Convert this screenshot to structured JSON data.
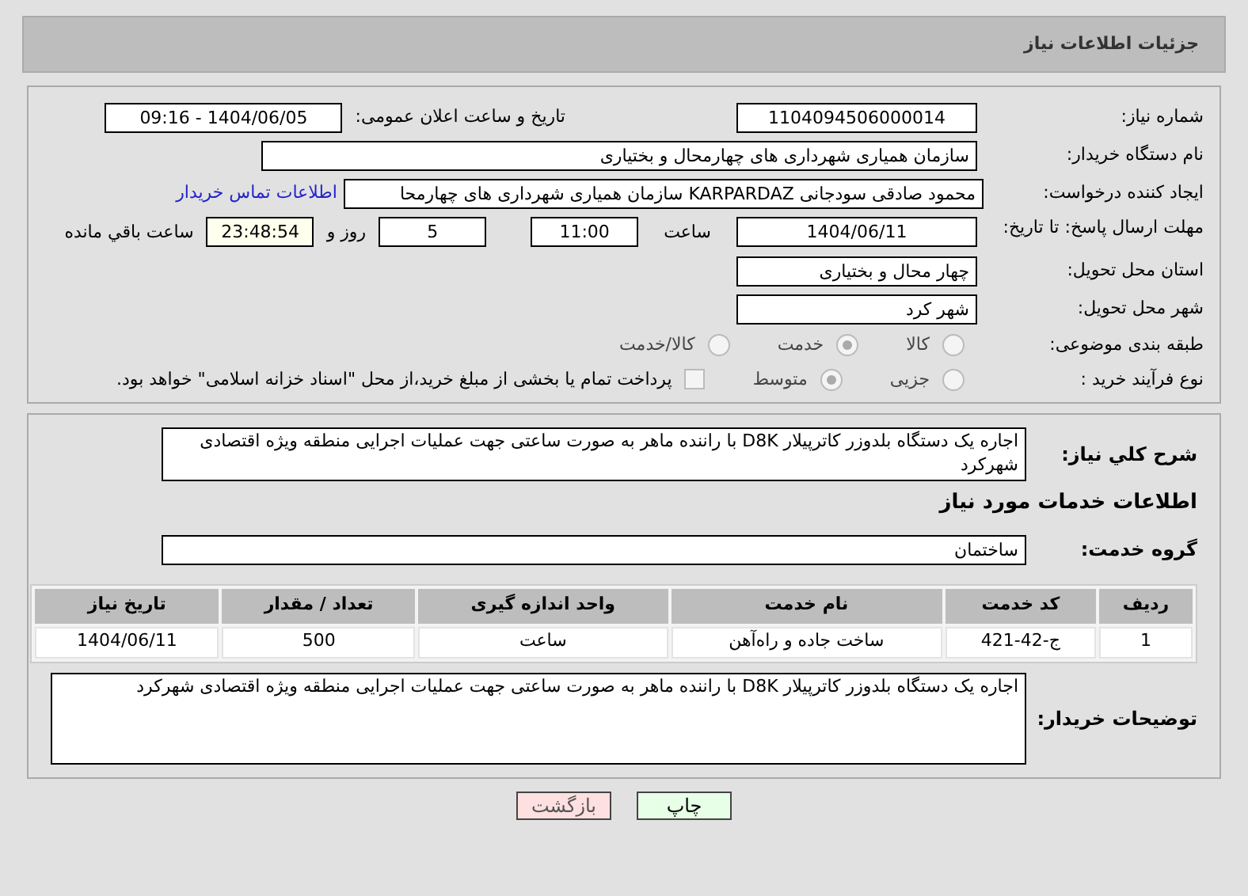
{
  "header": {
    "title": "جزئیات اطلاعات نیاز"
  },
  "details": {
    "need_number": {
      "label": "شماره نیاز:",
      "value": "1104094506000014"
    },
    "announce": {
      "label": "تاریخ و ساعت اعلان عمومی:",
      "value": "1404/06/05 - 09:16"
    },
    "buyer_org": {
      "label": "نام دستگاه خریدار:",
      "value": "سازمان همیاری شهرداری های چهارمحال و بختیاری"
    },
    "requester": {
      "label": "ایجاد کننده درخواست:",
      "value": "محمود صادقی سودجانی KARPARDAZ سازمان همیاری شهرداری های چهارمحا",
      "link": "اطلاعات تماس خریدار"
    },
    "deadline": {
      "label": "مهلت ارسال پاسخ: تا تاریخ:",
      "date": "1404/06/11",
      "time_label": "ساعت",
      "time": "11:00",
      "days": "5",
      "days_label": "روز و",
      "remaining": "23:48:54",
      "remaining_label": "ساعت باقي مانده"
    },
    "province": {
      "label": "استان محل تحویل:",
      "value": "چهار محال و بختیاری"
    },
    "city": {
      "label": "شهر محل تحویل:",
      "value": "شهر کرد"
    },
    "category": {
      "label": "طبقه بندی موضوعی:",
      "options": [
        {
          "label": "کالا",
          "selected": false
        },
        {
          "label": "خدمت",
          "selected": true
        },
        {
          "label": "کالا/خدمت",
          "selected": false
        }
      ]
    },
    "process": {
      "label": "نوع فرآیند خرید :",
      "options": [
        {
          "label": "جزیی",
          "selected": false
        },
        {
          "label": "متوسط",
          "selected": true
        }
      ],
      "payment": {
        "checked": false,
        "text": "پرداخت تمام یا بخشی از مبلغ خرید،از محل \"اسناد خزانه اسلامی\" خواهد بود."
      }
    }
  },
  "services": {
    "summary": {
      "label": "شرح کلي نياز:",
      "value": "اجاره یک دستگاه بلدوزر کاترپیلار D8K با راننده ماهر به صورت ساعتی جهت عملیات اجرایی منطقه ویژه اقتصادی شهرکرد"
    },
    "heading": "اطلاعات خدمات مورد نیاز",
    "group": {
      "label": "گروه خدمت:",
      "value": "ساختمان"
    },
    "table": {
      "columns": [
        "ردیف",
        "کد خدمت",
        "نام خدمت",
        "واحد اندازه گیری",
        "تعداد / مقدار",
        "تاریخ نیاز"
      ],
      "rows": [
        [
          "1",
          "ج-42-421",
          "ساخت جاده و راه‌آهن",
          "ساعت",
          "500",
          "1404/06/11"
        ]
      ]
    },
    "notes": {
      "label": "توضیحات خریدار:",
      "value": "اجاره یک دستگاه بلدوزر کاترپیلار D8K با راننده ماهر به صورت ساعتی جهت عملیات اجرایی منطقه ویژه اقتصادی شهرکرد"
    }
  },
  "buttons": [
    {
      "kind": "print",
      "label": "چاپ"
    },
    {
      "kind": "back",
      "label": "بازگشت"
    }
  ]
}
